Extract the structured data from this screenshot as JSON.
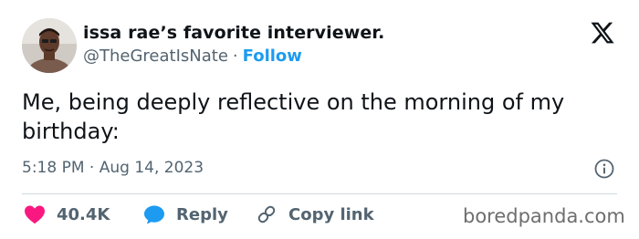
{
  "author": {
    "display_name": "issa rae’s favorite interviewer.",
    "handle": "@TheGreatIsNate",
    "separator": "·",
    "follow_label": "Follow"
  },
  "tweet": {
    "text": "Me, being deeply reflective on the morning of my birthday:",
    "time": "5:18 PM",
    "date": "Aug 14, 2023",
    "meta_separator": "·"
  },
  "actions": {
    "like_count": "40.4K",
    "reply_label": "Reply",
    "copy_link_label": "Copy link"
  },
  "watermark": "boredpanda.com",
  "icons": {
    "brand": "x-logo-icon",
    "info": "info-icon",
    "like": "heart-icon",
    "reply": "speech-bubble-icon",
    "copy": "link-icon"
  },
  "colors": {
    "text": "#0f1419",
    "secondary": "#536471",
    "follow": "#1d9bf0",
    "like": "#f91880",
    "reply": "#1d9bf0",
    "divider": "#cfd9de"
  }
}
